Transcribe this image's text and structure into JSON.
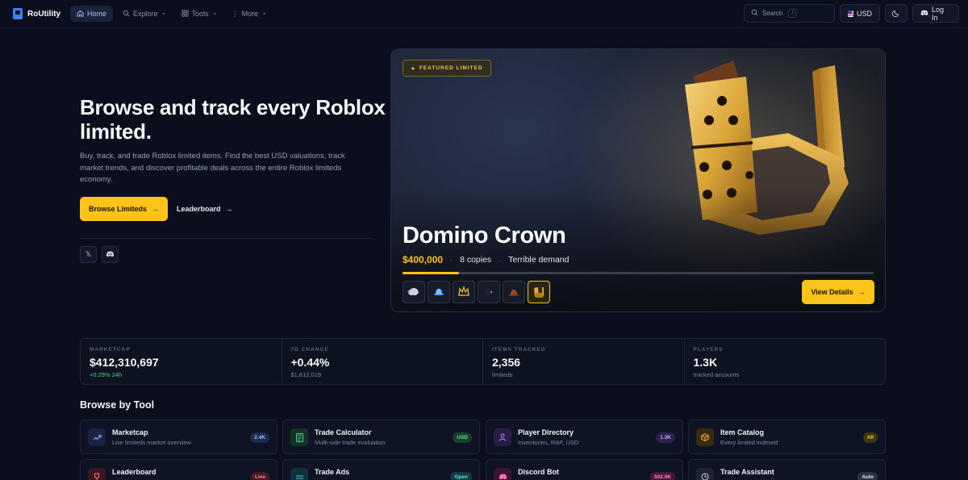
{
  "nav": {
    "logo": "RoUtility",
    "links": [
      {
        "label": "Home",
        "icon": "home-icon"
      },
      {
        "label": "Explore",
        "icon": "search-icon"
      },
      {
        "label": "Tools",
        "icon": "grid-icon"
      },
      {
        "label": "More",
        "icon": "dots-icon"
      }
    ],
    "search_label": "Search",
    "search_shortcut": "/",
    "currency": "USD",
    "login": "Log In"
  },
  "hero": {
    "title": "Browse and track every Roblox limited.",
    "description": "Buy, track, and trade Roblox limited items. Find the best USD valuations, track market trends, and discover profitable deals across the entire Roblox limiteds economy.",
    "primary_button": "Browse Limiteds",
    "secondary_button": "Leaderboard"
  },
  "featured": {
    "badge": "FEATURED LIMITED",
    "name": "Domino Crown",
    "price": "$400,000",
    "copies": "8 copies",
    "demand": "Terrible demand",
    "progress": 0.12,
    "view_button": "View Details",
    "thumbnails": [
      "valkyrie-helm",
      "sparkle-time-fedora",
      "golden-crown-small",
      "dominus-hat",
      "fedora-brown",
      "domino-crown"
    ],
    "active_thumbnail": 5,
    "accent": "#fcc419"
  },
  "stats": [
    {
      "label": "MARKETCAP",
      "value": "$412,310,697",
      "sub": "+0.29% 24h",
      "sub_positive": true
    },
    {
      "label": "7D CHANGE",
      "value": "+0.44%",
      "sub": "$1,812,019",
      "sub_positive": false
    },
    {
      "label": "ITEMS TRACKED",
      "value": "2,356",
      "sub": "limiteds",
      "sub_positive": false
    },
    {
      "label": "PLAYERS",
      "value": "1.3K",
      "sub": "tracked accounts",
      "sub_positive": false
    }
  ],
  "tools_section": {
    "title": "Browse by Tool",
    "tools": [
      {
        "name": "Marketcap",
        "desc": "Live limiteds market overview",
        "badge": "2.4K",
        "icon": "trend-icon"
      },
      {
        "name": "Trade Calculator",
        "desc": "Multi-side trade evaluation",
        "badge": "USD",
        "icon": "calculator-icon"
      },
      {
        "name": "Player Directory",
        "desc": "Inventories, RAP, USD",
        "badge": "1.3K",
        "icon": "user-icon"
      },
      {
        "name": "Item Catalog",
        "desc": "Every limited indexed",
        "badge": "All",
        "icon": "box-icon"
      },
      {
        "name": "Leaderboard",
        "desc": "",
        "badge": "Live",
        "icon": "trophy-icon"
      },
      {
        "name": "Trade Ads",
        "desc": "",
        "badge": "Open",
        "icon": "swap-icon"
      },
      {
        "name": "Discord Bot",
        "desc": "",
        "badge": "502.0K",
        "icon": "discord-icon"
      },
      {
        "name": "Trade Assistant",
        "desc": "",
        "badge": "Auto",
        "icon": "clock-icon"
      }
    ]
  },
  "colors": {
    "background": "#0b0f1d",
    "accent_yellow": "#fcc419",
    "positive_green": "#3ed38a",
    "link_blue": "#9cc3ff"
  }
}
